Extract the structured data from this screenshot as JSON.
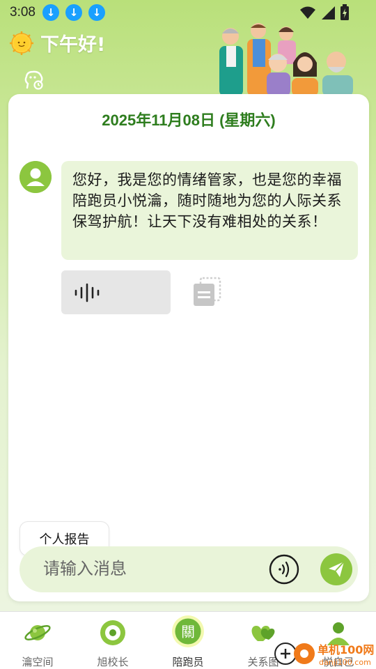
{
  "status_bar": {
    "time": "3:08",
    "download_badges": [
      "download-icon",
      "download-icon",
      "download-icon"
    ],
    "right_icons": [
      "wifi-icon",
      "signal-icon",
      "battery-charging-icon"
    ]
  },
  "header": {
    "greeting": "下午好!",
    "greeting_icon": "sun-icon",
    "emotion_icon": "emotion-brain-icon"
  },
  "chat": {
    "date": "2025年11月08日 (星期六)",
    "message": "您好，我是您的情绪管家，也是您的幸福陪跑员小悦瀹，随时随地为您的人际关系保驾护航！让天下没有难相处的关系！"
  },
  "report_button_label": "个人报告",
  "input": {
    "placeholder": "请输入消息"
  },
  "bottom_nav": [
    {
      "label": "瀹空间",
      "icon": "planet-icon"
    },
    {
      "label": "旭校长",
      "icon": "target-icon"
    },
    {
      "label": "陪跑员",
      "icon": "companion-glyph-icon",
      "glyph": "關",
      "active": true
    },
    {
      "label": "关系图",
      "icon": "hearts-icon"
    },
    {
      "label": "悦自己",
      "icon": "self-icon"
    }
  ],
  "watermark": {
    "text": "单机100网",
    "url_text": "danji100.com"
  },
  "colors": {
    "accent": "#8cc63f",
    "date_green": "#2e7d1e",
    "bubble_bg": "#eaf5da"
  }
}
